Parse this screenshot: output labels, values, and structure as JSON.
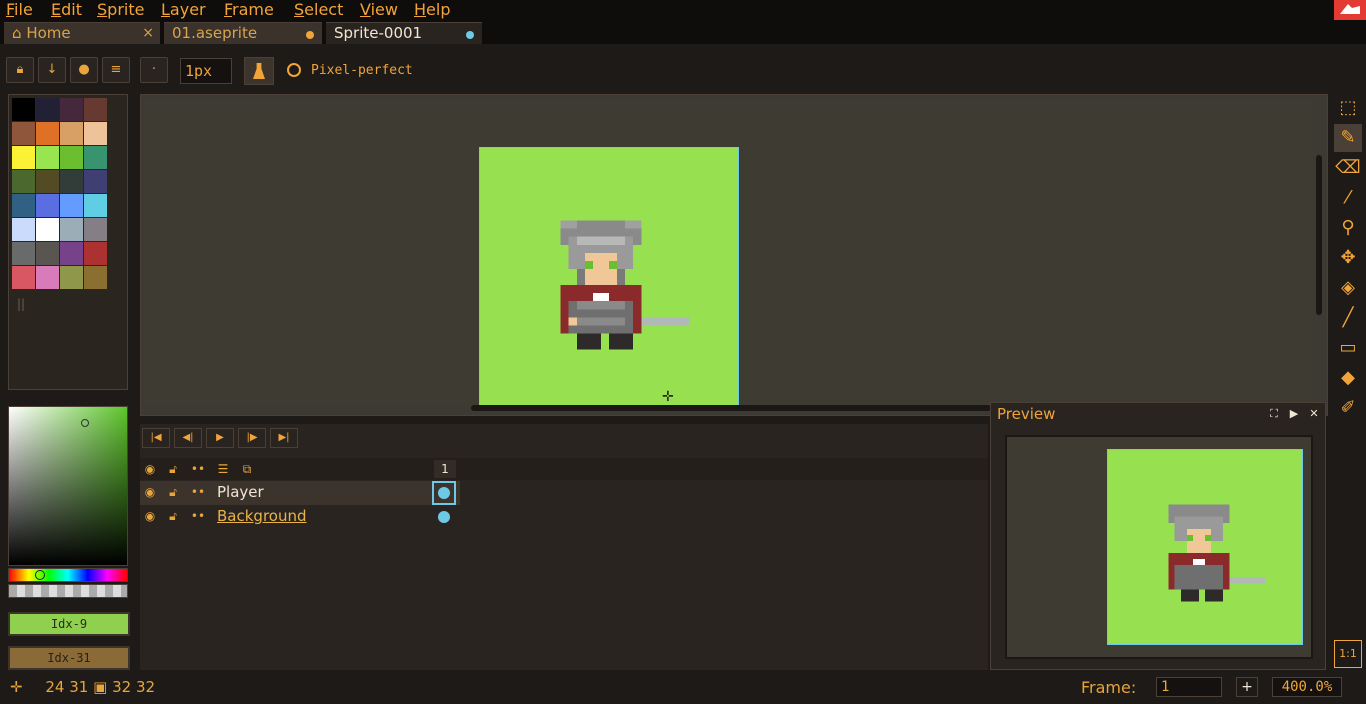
{
  "menu": {
    "items": [
      {
        "first": "F",
        "rest": "ile"
      },
      {
        "first": "E",
        "rest": "dit"
      },
      {
        "first": "S",
        "rest": "prite"
      },
      {
        "first": "L",
        "rest": "ayer"
      },
      {
        "first": "F",
        "rest": "rame"
      },
      {
        "first": "S",
        "rest": "elect"
      },
      {
        "first": "V",
        "rest": "iew"
      },
      {
        "first": "H",
        "rest": "elp"
      }
    ]
  },
  "tabs": [
    {
      "label": "Home",
      "icon": "home-icon",
      "close": "×"
    },
    {
      "label": "01.aseprite",
      "dot_color": "#f0a43a"
    },
    {
      "label": "Sprite-0001",
      "dot_color": "#6dc9e6"
    }
  ],
  "context_bar": {
    "brush_size": "1px",
    "pixel_perfect_label": "Pixel-perfect",
    "buttons": [
      "lock-icon",
      "arrow-down-icon",
      "circle-icon",
      "menu-icon",
      "dot-icon"
    ]
  },
  "palette": {
    "colors": [
      "#000000",
      "#222034",
      "#45283c",
      "#663931",
      "#8f563b",
      "#df7126",
      "#d9a066",
      "#eec39a",
      "#fbf236",
      "#99e550",
      "#6abe30",
      "#37946e",
      "#4b692f",
      "#524b24",
      "#323c39",
      "#3f3f74",
      "#306082",
      "#5b6ee1",
      "#639bff",
      "#5fcde4",
      "#cbdbfc",
      "#ffffff",
      "#9badb7",
      "#847e87",
      "#696a6a",
      "#595652",
      "#76428a",
      "#ac3232",
      "#d95763",
      "#d77bba",
      "#8f974a",
      "#8a6f30"
    ]
  },
  "colors": {
    "fg_label": "Idx-9",
    "bg_label": "Idx-31",
    "fg": "#8fd14f",
    "bg": "#8a6a36"
  },
  "timeline": {
    "controls": [
      "first-frame-icon",
      "prev-frame-icon",
      "play-icon",
      "next-frame-icon",
      "last-frame-icon"
    ],
    "frame_number": "1",
    "layers": [
      {
        "name": "Player",
        "selected": true
      },
      {
        "name": "Background",
        "selected": false
      }
    ]
  },
  "preview": {
    "title": "Preview"
  },
  "tools": [
    "rectangular-marquee-icon",
    "pencil-icon",
    "eraser-icon",
    "eyedropper-icon",
    "zoom-icon",
    "move-icon",
    "paint-bucket-icon",
    "line-icon",
    "rectangle-icon",
    "contour-icon",
    "blur-icon"
  ],
  "status": {
    "cursor_x": "24",
    "cursor_y": "31",
    "size_w": "32",
    "size_h": "32",
    "frame_label": "Frame:",
    "frame_value": "1",
    "add_frame": "+",
    "zoom": "400.0%",
    "one_to_one": "1:1"
  }
}
